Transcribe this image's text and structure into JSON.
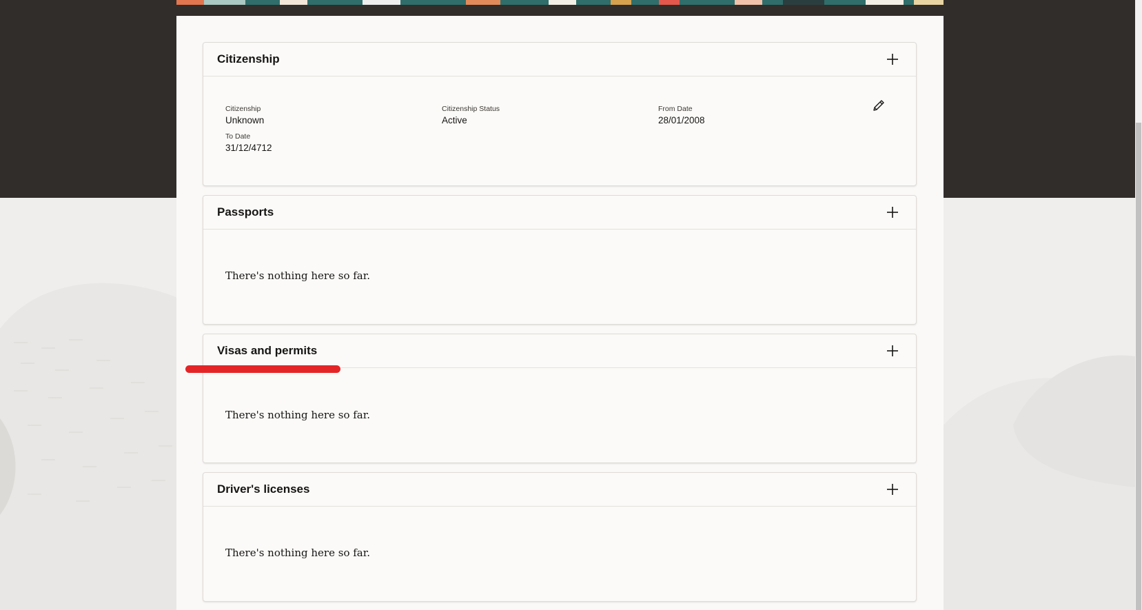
{
  "sections": {
    "citizenship": {
      "title": "Citizenship",
      "fields": {
        "citizenship_label": "Citizenship",
        "citizenship_value": "Unknown",
        "status_label": "Citizenship Status",
        "status_value": "Active",
        "from_date_label": "From Date",
        "from_date_value": "28/01/2008",
        "to_date_label": "To Date",
        "to_date_value": "31/12/4712"
      }
    },
    "passports": {
      "title": "Passports",
      "empty_message": "There's nothing here so far."
    },
    "visas": {
      "title": "Visas and permits",
      "empty_message": "There's nothing here so far."
    },
    "drivers_licenses": {
      "title": "Driver's licenses",
      "empty_message": "There's nothing here so far."
    }
  },
  "icons": {
    "add": "plus-icon",
    "edit": "pencil-icon"
  },
  "colors": {
    "header_dark": "#312d2a",
    "page_background": "#efeeec",
    "panel_background": "#fbf9f8",
    "annotation_red": "#e42527"
  }
}
